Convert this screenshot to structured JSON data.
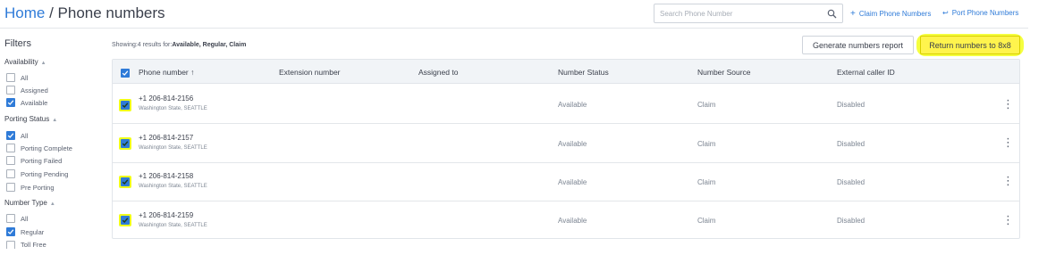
{
  "breadcrumb": {
    "home": "Home",
    "separator": " / ",
    "current": "Phone numbers"
  },
  "search": {
    "placeholder": "Search Phone Number",
    "icon": "search-icon"
  },
  "actions": {
    "claim": "Claim Phone Numbers",
    "port": "Port Phone Numbers"
  },
  "filters": {
    "title": "Filters",
    "groups": [
      {
        "title": "Availability",
        "options": [
          {
            "label": "All",
            "checked": false
          },
          {
            "label": "Assigned",
            "checked": false
          },
          {
            "label": "Available",
            "checked": true
          }
        ]
      },
      {
        "title": "Porting Status",
        "options": [
          {
            "label": "All",
            "checked": true
          },
          {
            "label": "Porting Complete",
            "checked": false
          },
          {
            "label": "Porting Failed",
            "checked": false
          },
          {
            "label": "Porting Pending",
            "checked": false
          },
          {
            "label": "Pre Porting",
            "checked": false
          }
        ]
      },
      {
        "title": "Number Type",
        "options": [
          {
            "label": "All",
            "checked": false
          },
          {
            "label": "Regular",
            "checked": true
          },
          {
            "label": "Toll Free",
            "checked": false
          }
        ]
      }
    ]
  },
  "results": {
    "prefix": "Showing:4 results for:",
    "filters": "Available, Regular, Claim"
  },
  "buttons": {
    "report": "Generate numbers report",
    "return": "Return numbers to 8x8"
  },
  "table": {
    "columns": [
      "Phone number",
      "Extension number",
      "Assigned to",
      "Number Status",
      "Number Source",
      "External caller ID"
    ],
    "sort_indicator": "↑",
    "rows": [
      {
        "number": "+1 206-814-2156",
        "location": "Washington State, SEATTLE",
        "extension": "",
        "assigned": "",
        "status": "Available",
        "source": "Claim",
        "caller_id": "Disabled",
        "checked": true
      },
      {
        "number": "+1 206-814-2157",
        "location": "Washington State, SEATTLE",
        "extension": "",
        "assigned": "",
        "status": "Available",
        "source": "Claim",
        "caller_id": "Disabled",
        "checked": true
      },
      {
        "number": "+1 206-814-2158",
        "location": "Washington State, SEATTLE",
        "extension": "",
        "assigned": "",
        "status": "Available",
        "source": "Claim",
        "caller_id": "Disabled",
        "checked": true
      },
      {
        "number": "+1 206-814-2159",
        "location": "Washington State, SEATTLE",
        "extension": "",
        "assigned": "",
        "status": "Available",
        "source": "Claim",
        "caller_id": "Disabled",
        "checked": true
      }
    ]
  },
  "colors": {
    "accent": "#2f7bd8",
    "highlight": "#f4ff2a",
    "header_bg": "#f1f4f7"
  }
}
